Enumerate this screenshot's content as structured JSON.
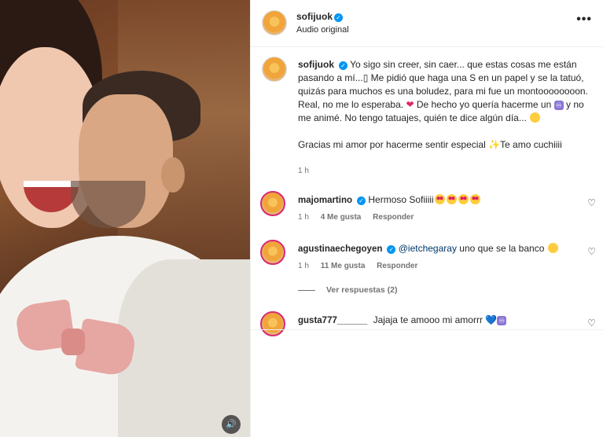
{
  "post": {
    "username": "sofijuok",
    "audio_label": "Audio original",
    "more_label": "•••"
  },
  "caption": {
    "username": "sofijuok",
    "line1": "Yo sigo sin creer, sin caer... que estas cosas me están pasando a mí...",
    "glyph1": "󠀠",
    "line1b": " Me pidió que haga una S en un papel y se la tatuó, quizás para muchos es una boludez, para mi fue un montoooooooon. Real, no me lo esperaba.",
    "part2a": " De hecho yo quería hacerme un ",
    "part2b": " y no me animé. No tengo tatuajes, quién te dice algún día...",
    "line3a": "Gracias mi amor por hacerme sentir especial ",
    "line3b": "Te amo cuchiiii",
    "time": "1 h",
    "inf_glyph": "♾",
    "heart_glyph": "❤",
    "sparkle_glyph": "✨"
  },
  "comments": [
    {
      "username": "majomartino",
      "text": "Hermoso Sofiiiii",
      "time": "1 h",
      "likes": "4 Me gusta",
      "reply_label": "Responder"
    },
    {
      "username": "agustinaechegoyen",
      "mention": "@ietchegaray",
      "text": " uno que se la banco ",
      "time": "1 h",
      "likes": "11 Me gusta",
      "reply_label": "Responder"
    },
    {
      "username": "gusta777______",
      "text": "Jajaja te amooo mi amorrr ",
      "heart_glyph": "💙",
      "inf_glyph": "♾"
    }
  ],
  "view_replies": "Ver respuestas (2)",
  "icons": {
    "heart": "♡",
    "sound": "🔊"
  },
  "colors": {
    "verified": "#0095f6",
    "story_ring": "#d62976",
    "mention": "#00376b"
  }
}
